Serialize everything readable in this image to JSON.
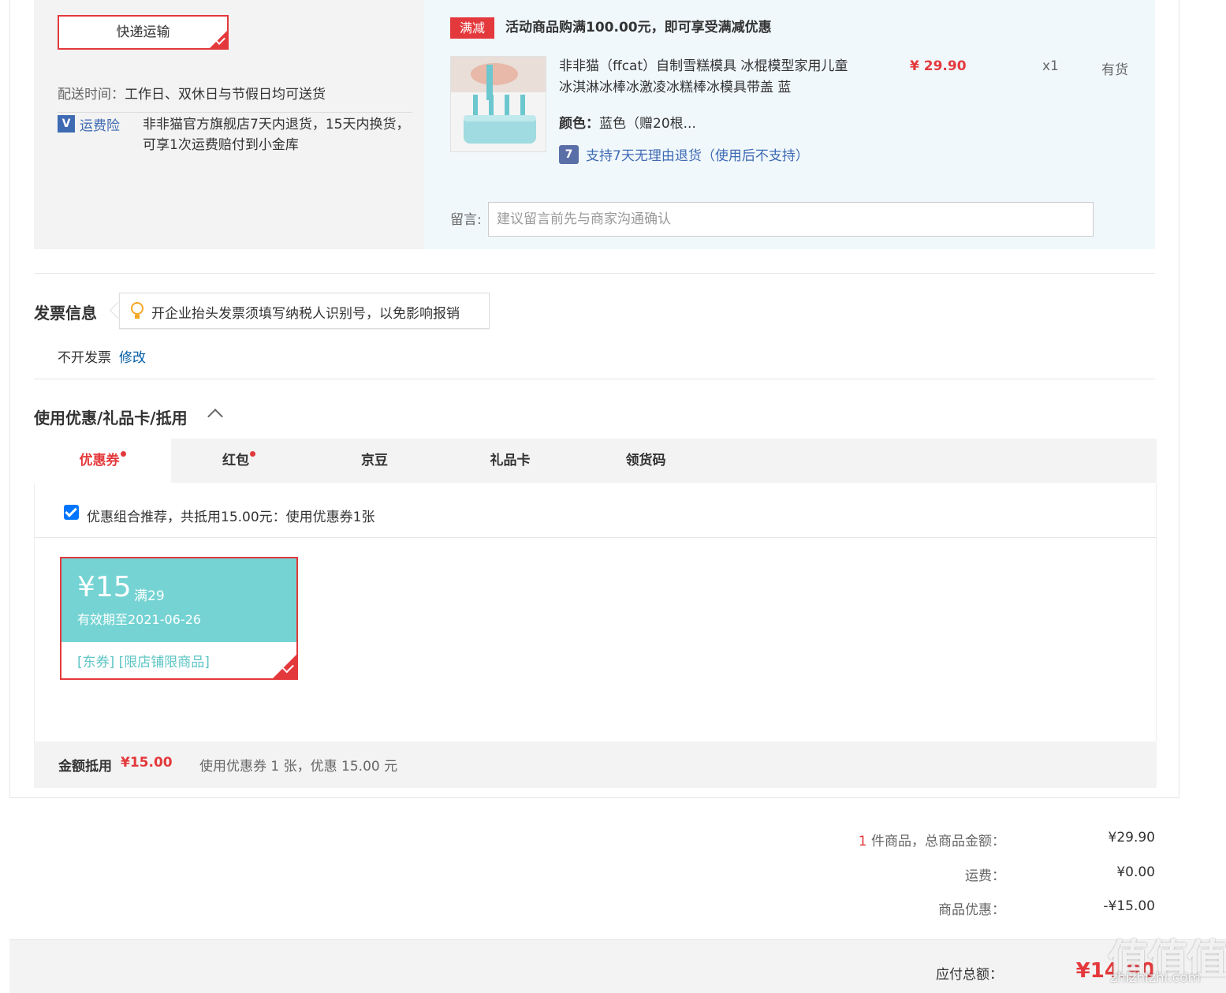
{
  "shipping": {
    "method_label": "快递运输",
    "delivery_label": "配送时间：",
    "delivery_value": "工作日、双休日与节假日均可送货",
    "insurance_icon": "V",
    "insurance_label": "运费险",
    "insurance_text": "非非猫官方旗舰店7天内退货，15天内换货，可享1次运费赔付到小金库"
  },
  "order": {
    "promo_tag": "满减",
    "promo_text": "活动商品购满100.00元，即可享受满减优惠",
    "product_title": "非非猫（ffcat）自制雪糕模具 冰棍模型家用儿童冰淇淋冰棒冰激凌冰糕棒冰模具带盖 蓝",
    "price": "¥ 29.90",
    "qty": "x1",
    "stock": "有货",
    "color_label": "颜色：",
    "color_value": "蓝色（赠20根...",
    "return_icon": "7",
    "return_policy": "支持7天无理由退货（使用后不支持）",
    "message_label": "留言:",
    "message_placeholder": "建议留言前先与商家沟通确认"
  },
  "invoice": {
    "title": "发票信息",
    "tip": "开企业抬头发票须填写纳税人识别号，以免影响报销",
    "value": "不开发票",
    "edit_label": "修改"
  },
  "discount": {
    "title": "使用优惠/礼品卡/抵用",
    "tabs": [
      {
        "label": "优惠券",
        "has_dot": true,
        "active": true
      },
      {
        "label": "红包",
        "has_dot": true,
        "active": false
      },
      {
        "label": "京豆",
        "has_dot": false,
        "active": false
      },
      {
        "label": "礼品卡",
        "has_dot": false,
        "active": false
      },
      {
        "label": "领货码",
        "has_dot": false,
        "active": false
      }
    ],
    "combo_text": "优惠组合推荐，共抵用15.00元：使用优惠券1张",
    "combo_checked": true,
    "coupon": {
      "amount": "¥15",
      "min": "满29",
      "valid": "有效期至2021-06-26",
      "tags": "[东券] [限店铺限商品]",
      "selected": true
    },
    "summary_label": "金额抵用",
    "summary_amount": "¥15.00",
    "summary_detail": "使用优惠券 1 张，优惠 15.00 元"
  },
  "totals": {
    "count": "1",
    "count_label": "件商品，总商品金额：",
    "goods_amount": "¥29.90",
    "shipping_label": "运费：",
    "shipping_amount": "¥0.00",
    "discount_label": "商品优惠：",
    "discount_amount": "-¥15.00",
    "payable_label": "应付总额：",
    "payable_amount": "¥14.90"
  },
  "watermark": {
    "text": "值值值",
    "sub": "zhizhizhi.com"
  },
  "colors": {
    "accent": "#e4393c",
    "coupon": "#75d3d3",
    "link": "#005ea7"
  }
}
